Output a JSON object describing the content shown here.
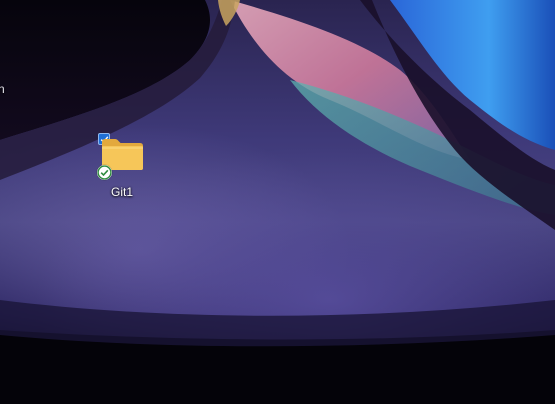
{
  "desktop": {
    "edge_text": "n",
    "icons": [
      {
        "label": "Git1",
        "icon": "folder-icon",
        "selected": true,
        "sync_status": "synced-check-badge"
      }
    ]
  },
  "colors": {
    "folder": "#f6c659",
    "selection_check": "#1f6fd6",
    "sync_check": "#2e8b3e"
  }
}
